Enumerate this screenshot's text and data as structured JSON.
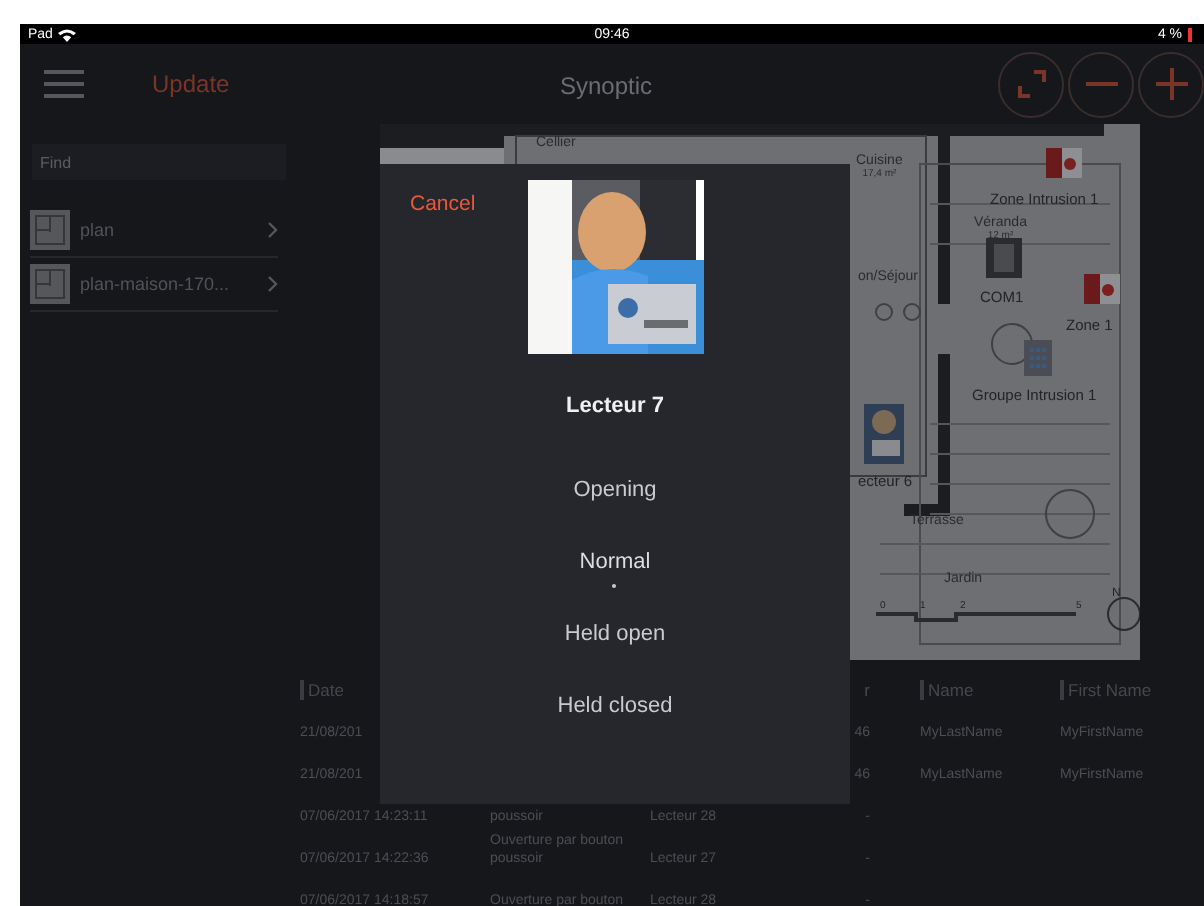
{
  "status_bar": {
    "carrier": "Pad",
    "time": "09:46",
    "battery": "4 %"
  },
  "header": {
    "back_label": "Update",
    "title": "Synoptic"
  },
  "sidebar": {
    "search": {
      "placeholder": "Find"
    },
    "items": [
      {
        "label": "plan"
      },
      {
        "label": "plan-maison-170..."
      }
    ]
  },
  "plan": {
    "rooms": [
      {
        "label": "Cellier"
      },
      {
        "label": "Cuisine",
        "area": "17,4 m²"
      },
      {
        "label": "Véranda",
        "area": "12 m²"
      },
      {
        "label": "on/Séjour"
      },
      {
        "label": "Terrasse"
      },
      {
        "label": "Jardin"
      }
    ],
    "devices": [
      {
        "kind": "alarm",
        "label": "Zone Intrusion 1"
      },
      {
        "kind": "controller",
        "label": "COM1"
      },
      {
        "kind": "alarm",
        "label": "Zone 1"
      },
      {
        "kind": "keypad",
        "label": "Groupe Intrusion 1"
      },
      {
        "kind": "reader",
        "label": "ecteur 6"
      }
    ],
    "scale": [
      "0",
      "1",
      "2",
      "5"
    ],
    "compass": "N"
  },
  "log_table": {
    "columns": {
      "date": "Date",
      "column_4": "r",
      "name": "Name",
      "first_name": "First Name"
    },
    "rows": [
      {
        "date": "21/08/201",
        "column_4": "46",
        "name": "MyLastName",
        "first_name": "MyFirstName"
      },
      {
        "date": "21/08/201",
        "column_4": "46",
        "name": "MyLastName",
        "first_name": "MyFirstName"
      },
      {
        "date": "07/06/2017 14:23:11",
        "event": "poussoir",
        "reader": "Lecteur 28",
        "column_4": "-"
      },
      {
        "date": "07/06/2017 14:22:36",
        "event": "Ouverture par bouton poussoir",
        "reader": "Lecteur 27",
        "column_4": "-"
      },
      {
        "date": "07/06/2017 14:18:57",
        "event": "Ouverture par bouton",
        "reader": "Lecteur 28",
        "column_4": "-"
      }
    ]
  },
  "dialog": {
    "cancel": "Cancel",
    "title": "Lecteur 7",
    "options": [
      {
        "label": "Opening",
        "selected": false
      },
      {
        "label": "Normal",
        "selected": true
      },
      {
        "label": "Held open",
        "selected": false
      },
      {
        "label": "Held closed",
        "selected": false
      }
    ]
  }
}
